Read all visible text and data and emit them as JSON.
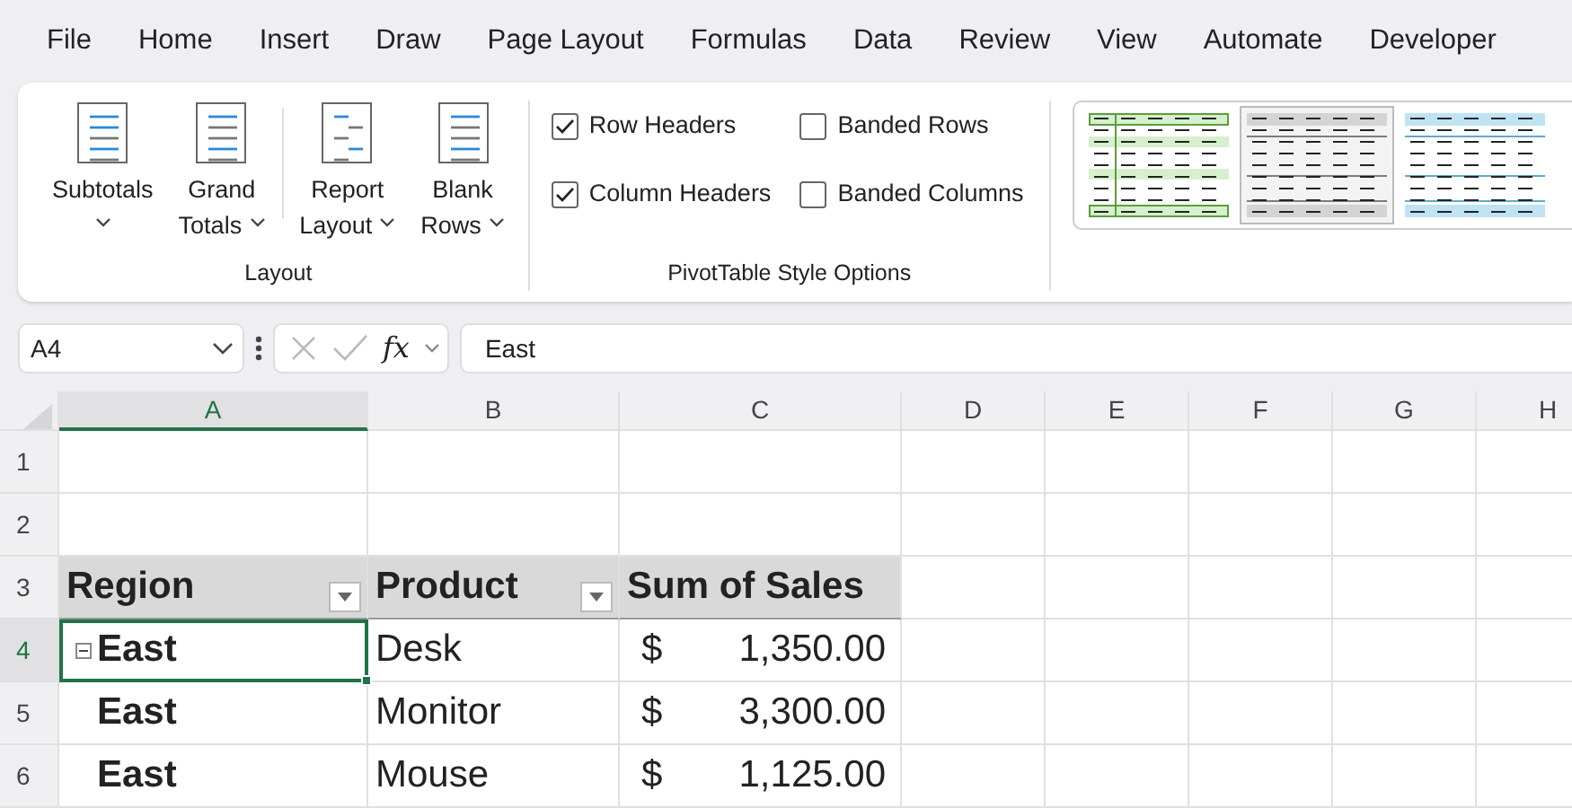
{
  "menu_tabs": [
    {
      "label": "File"
    },
    {
      "label": "Home"
    },
    {
      "label": "Insert"
    },
    {
      "label": "Draw"
    },
    {
      "label": "Page Layout"
    },
    {
      "label": "Formulas"
    },
    {
      "label": "Data"
    },
    {
      "label": "Review"
    },
    {
      "label": "View"
    },
    {
      "label": "Automate"
    },
    {
      "label": "Developer"
    }
  ],
  "ribbon": {
    "layout_group": {
      "label": "Layout",
      "button_sets": [
        [
          {
            "lines": [
              "Subtotals"
            ]
          },
          {
            "lines": [
              "Grand",
              "Totals"
            ]
          }
        ],
        [
          {
            "lines": [
              "Report",
              "Layout"
            ]
          },
          {
            "lines": [
              "Blank",
              "Rows"
            ]
          }
        ]
      ]
    },
    "style_options_group": {
      "label": "PivotTable Style Options",
      "options": [
        {
          "label": "Row Headers",
          "checked": true
        },
        {
          "label": "Banded Rows",
          "checked": false
        },
        {
          "label": "Column Headers",
          "checked": true
        },
        {
          "label": "Banded Columns",
          "checked": false
        }
      ]
    },
    "styles": [
      {
        "selected": false
      },
      {
        "selected": true
      },
      {
        "selected": false
      }
    ]
  },
  "formula_bar": {
    "name_box": "A4",
    "function_label": "fx",
    "value": "East"
  },
  "sheet": {
    "columns": [
      {
        "label": "A",
        "selected": true
      },
      {
        "label": "B",
        "selected": false
      },
      {
        "label": "C",
        "selected": false
      },
      {
        "label": "D",
        "selected": false
      },
      {
        "label": "E",
        "selected": false
      },
      {
        "label": "F",
        "selected": false
      },
      {
        "label": "G",
        "selected": false
      },
      {
        "label": "H",
        "selected": false
      }
    ],
    "rows": [
      {
        "number": "1",
        "selected": false,
        "cells": []
      },
      {
        "number": "2",
        "selected": false,
        "cells": []
      },
      {
        "number": "3",
        "selected": false,
        "cells": [
          {
            "kind": "header",
            "text": "Region",
            "filter": true
          },
          {
            "kind": "header",
            "text": "Product",
            "filter": true
          },
          {
            "kind": "header",
            "text": "Sum of Sales",
            "filter": false
          }
        ]
      },
      {
        "number": "4",
        "selected": true,
        "cells": [
          {
            "kind": "row_label",
            "text": "East",
            "expanded": true,
            "selected": true
          },
          {
            "kind": "text",
            "text": "Desk",
            "selected": false
          },
          {
            "kind": "currency",
            "symbol": "$",
            "amount": "1,350.00",
            "selected": false
          }
        ]
      },
      {
        "number": "5",
        "selected": false,
        "cells": [
          {
            "kind": "row_label",
            "text": "East",
            "selected": false
          },
          {
            "kind": "text",
            "text": "Monitor",
            "selected": false
          },
          {
            "kind": "currency",
            "symbol": "$",
            "amount": "3,300.00",
            "selected": false
          }
        ]
      },
      {
        "number": "6",
        "selected": false,
        "cells": [
          {
            "kind": "row_label",
            "text": "East",
            "selected": false
          },
          {
            "kind": "text",
            "text": "Mouse",
            "selected": false
          },
          {
            "kind": "currency",
            "symbol": "$",
            "amount": "1,125.00",
            "selected": false
          }
        ]
      }
    ]
  }
}
